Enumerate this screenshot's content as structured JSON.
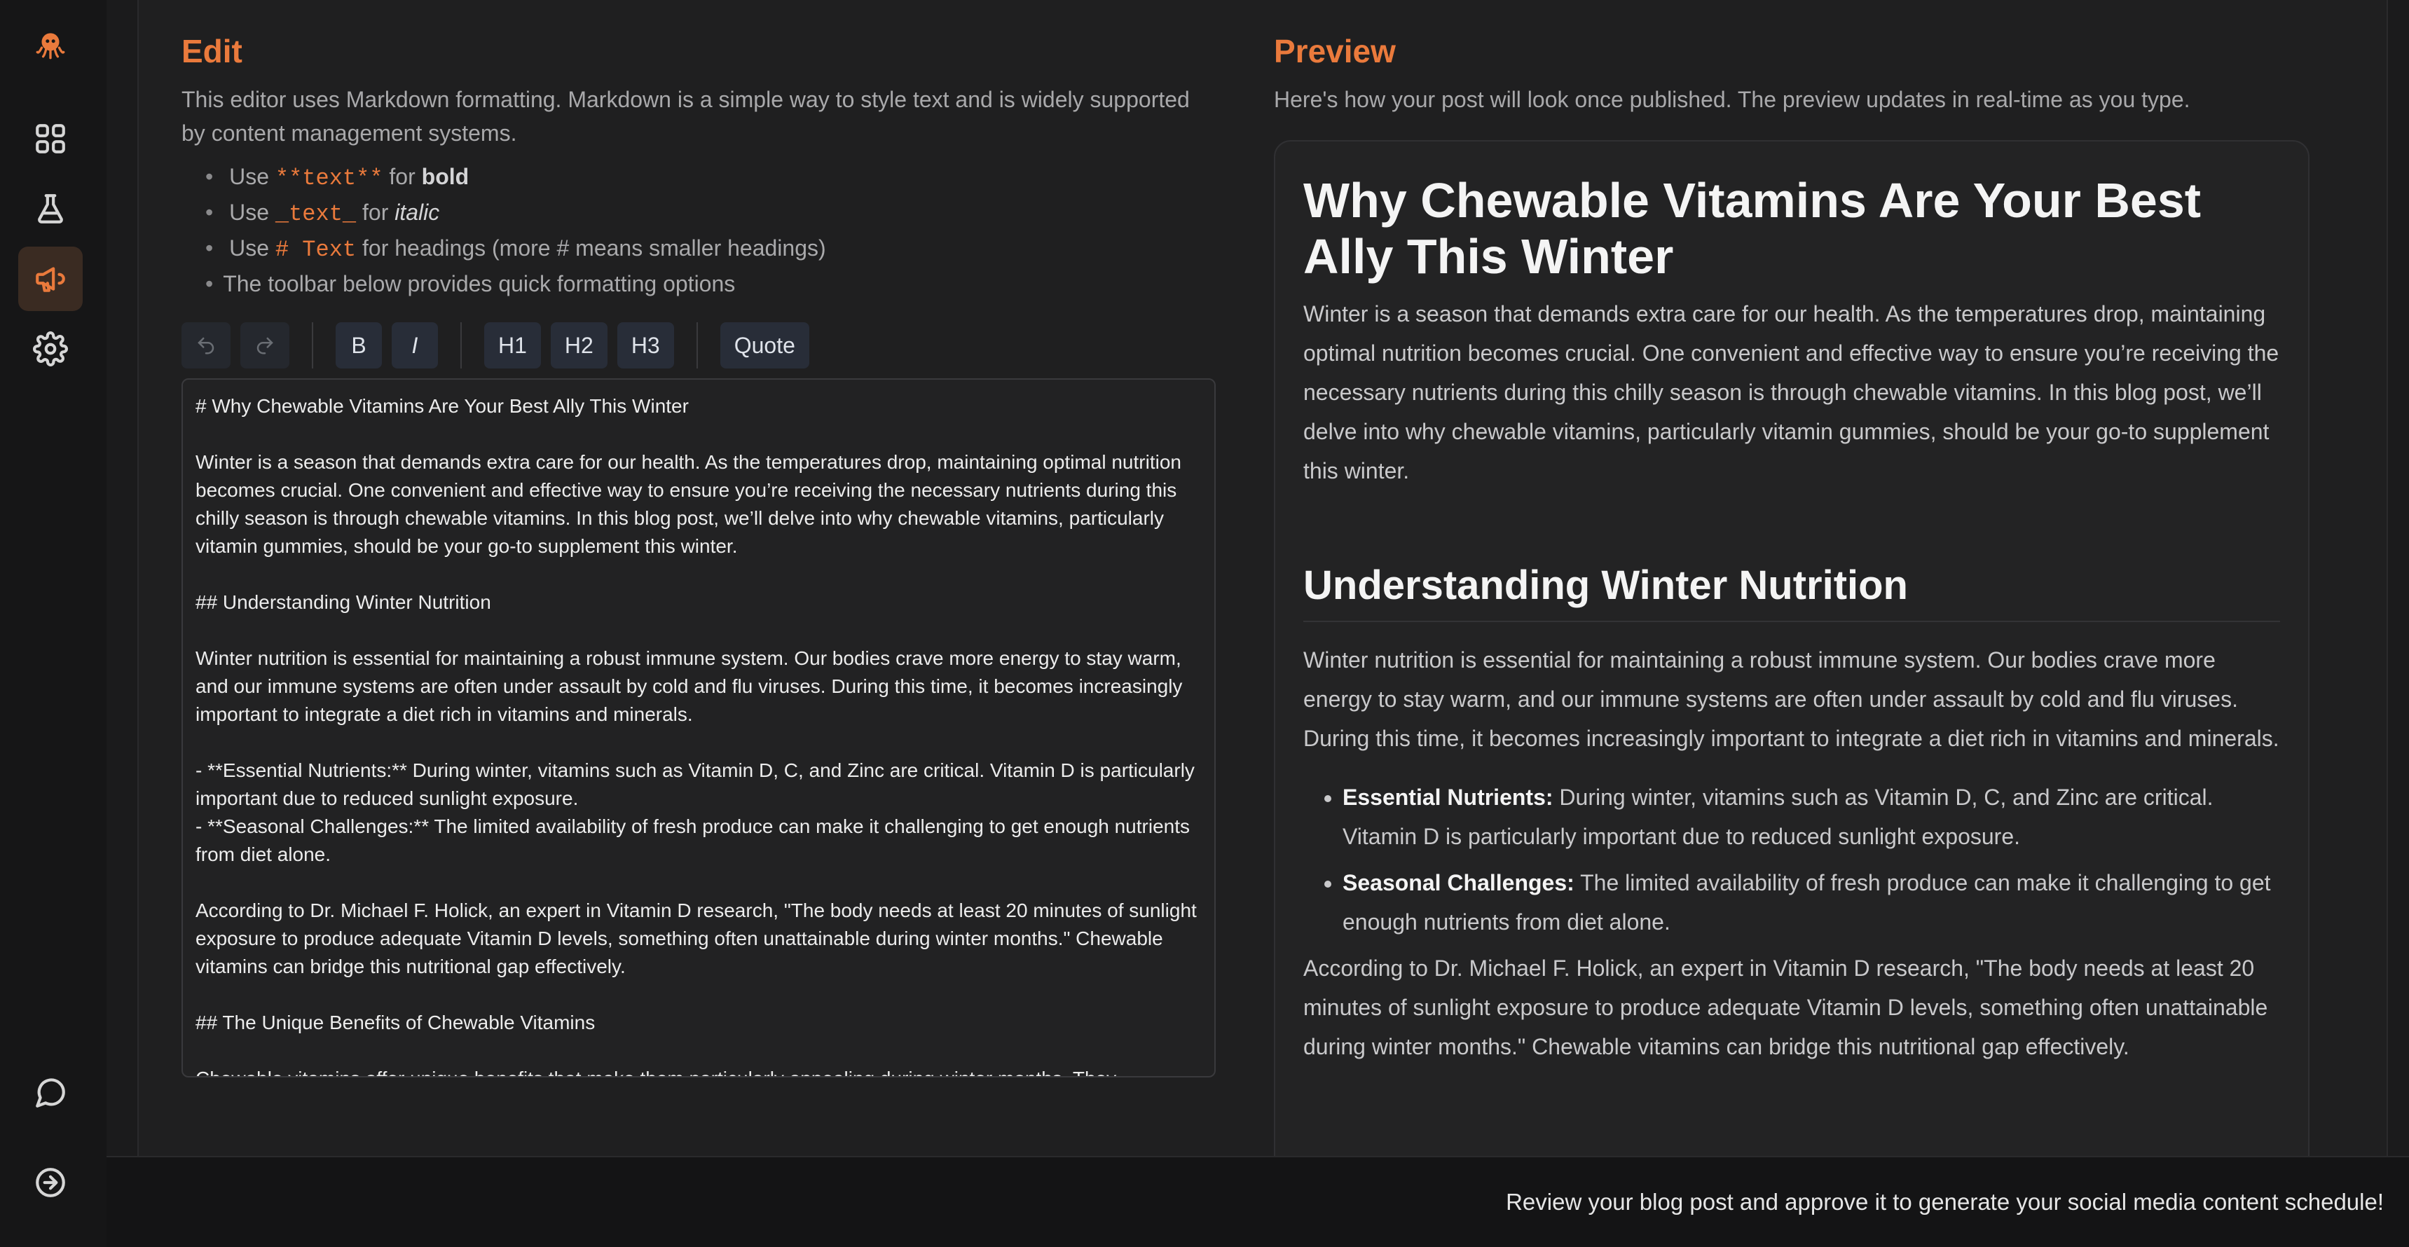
{
  "colors": {
    "accent": "#ea7a3c",
    "background": "#1f1f20",
    "rail": "#161617"
  },
  "rail": {
    "logo_icon": "octopus-logo-icon",
    "items": [
      {
        "icon": "grid-icon",
        "active": false
      },
      {
        "icon": "flask-icon",
        "active": false
      },
      {
        "icon": "megaphone-icon",
        "active": true
      },
      {
        "icon": "gear-icon",
        "active": false
      }
    ],
    "bottom": [
      {
        "icon": "chat-icon"
      },
      {
        "icon": "arrow-right-circle-icon"
      }
    ]
  },
  "edit": {
    "title": "Edit",
    "description": "This editor uses Markdown formatting. Markdown is a simple way to style text and is widely supported by content management systems.",
    "tips": {
      "use": "Use",
      "bold_code": "**text**",
      "for": "for",
      "bold_word": "bold",
      "italic_code": "_text_",
      "italic_word": "italic",
      "heading_code": "# Text",
      "heading_rest": "for headings (more # means smaller headings)",
      "toolbar": "The toolbar below provides quick formatting options"
    },
    "toolbar": {
      "undo_icon": "undo-icon",
      "redo_icon": "redo-icon",
      "bold": "B",
      "italic": "I",
      "h1": "H1",
      "h2": "H2",
      "h3": "H3",
      "quote": "Quote"
    },
    "content": "# Why Chewable Vitamins Are Your Best Ally This Winter\n\nWinter is a season that demands extra care for our health. As the temperatures drop, maintaining optimal nutrition becomes crucial. One convenient and effective way to ensure you’re receiving the necessary nutrients during this chilly season is through chewable vitamins. In this blog post, we’ll delve into why chewable vitamins, particularly vitamin gummies, should be your go-to supplement this winter.\n\n## Understanding Winter Nutrition\n\nWinter nutrition is essential for maintaining a robust immune system. Our bodies crave more energy to stay warm, and our immune systems are often under assault by cold and flu viruses. During this time, it becomes increasingly important to integrate a diet rich in vitamins and minerals.\n\n- **Essential Nutrients:** During winter, vitamins such as Vitamin D, C, and Zinc are critical. Vitamin D is particularly important due to reduced sunlight exposure.\n- **Seasonal Challenges:** The limited availability of fresh produce can make it challenging to get enough nutrients from diet alone.\n\nAccording to Dr. Michael F. Holick, an expert in Vitamin D research, \"The body needs at least 20 minutes of sunlight exposure to produce adequate Vitamin D levels, something often unattainable during winter months.\" Chewable vitamins can bridge this nutritional gap effectively.\n\n## The Unique Benefits of Chewable Vitamins\n\nChewable vitamins offer unique benefits that make them particularly appealing during winter months. They"
  },
  "preview": {
    "title": "Preview",
    "description": "Here's how your post will look once published. The preview updates in real-time as you type.",
    "h1": "Why Chewable Vitamins Are Your Best Ally This Winter",
    "p1": "Winter is a season that demands extra care for our health. As the temperatures drop, maintaining optimal nutrition becomes crucial. One convenient and effective way to ensure you’re receiving the necessary nutrients during this chilly season is through chewable vitamins. In this blog post, we’ll delve into why chewable vitamins, particularly vitamin gummies, should be your go-to supplement this winter.",
    "h2": "Understanding Winter Nutrition",
    "p2": "Winter nutrition is essential for maintaining a robust immune system. Our bodies crave more energy to stay warm, and our immune systems are often under assault by cold and flu viruses. During this time, it becomes increasingly important to integrate a diet rich in vitamins and minerals.",
    "bullets": [
      {
        "bold": "Essential Nutrients:",
        "text": " During winter, vitamins such as Vitamin D, C, and Zinc are critical. Vitamin D is particularly important due to reduced sunlight exposure."
      },
      {
        "bold": "Seasonal Challenges:",
        "text": " The limited availability of fresh produce can make it challenging to get enough nutrients from diet alone."
      }
    ],
    "p3": "According to Dr. Michael F. Holick, an expert in Vitamin D research, \"The body needs at least 20 minutes of sunlight exposure to produce adequate Vitamin D levels, something often unattainable during winter months.\" Chewable vitamins can bridge this nutritional gap effectively."
  },
  "footer": {
    "message": "Review your blog post and approve it to generate your social media content schedule!"
  }
}
